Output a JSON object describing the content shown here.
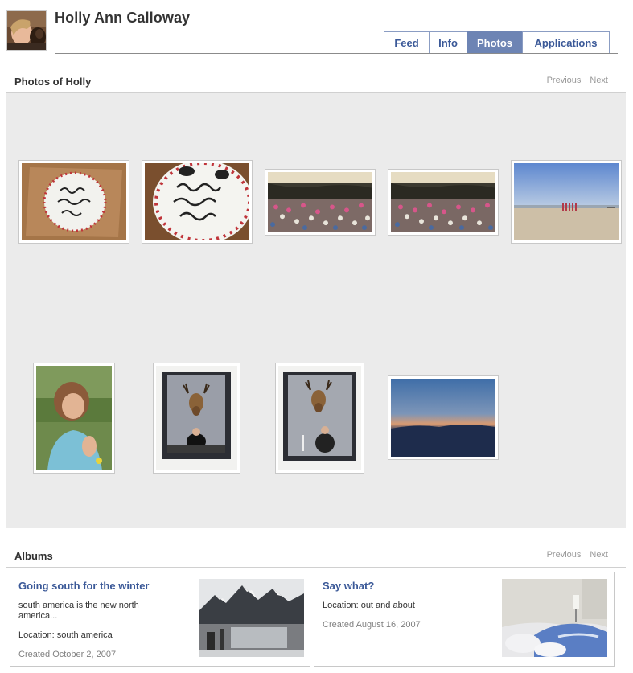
{
  "profile": {
    "name": "Holly Ann Calloway"
  },
  "tabs": [
    {
      "label": "Feed"
    },
    {
      "label": "Info"
    },
    {
      "label": "Photos"
    },
    {
      "label": "Applications"
    }
  ],
  "active_tab": "Photos",
  "photos_section": {
    "title": "Photos of Holly",
    "previous": "Previous",
    "next": "Next",
    "photos": [
      {
        "subject": "birthday cake in box"
      },
      {
        "subject": "birthday cake close-up"
      },
      {
        "subject": "crowd under cliff"
      },
      {
        "subject": "crowd under cliff"
      },
      {
        "subject": "beach with people"
      },
      {
        "subject": "girl in blue shirt"
      },
      {
        "subject": "person under mounted deer head"
      },
      {
        "subject": "person under mounted deer head"
      },
      {
        "subject": "sunset over mountains"
      }
    ]
  },
  "albums_section": {
    "title": "Albums",
    "previous": "Previous",
    "next": "Next",
    "albums": [
      {
        "title": "Going south for the winter",
        "description": "south america is the new north america...",
        "location": "Location: south america",
        "created": "Created October 2, 2007"
      },
      {
        "title": "Say what?",
        "location": "Location: out and about",
        "created": "Created August 16, 2007"
      }
    ]
  },
  "colors": {
    "link": "#3b5998",
    "active_tab": "#6d84b4",
    "tab_border": "#8b9dc3",
    "panel_bg": "#ebebeb"
  }
}
